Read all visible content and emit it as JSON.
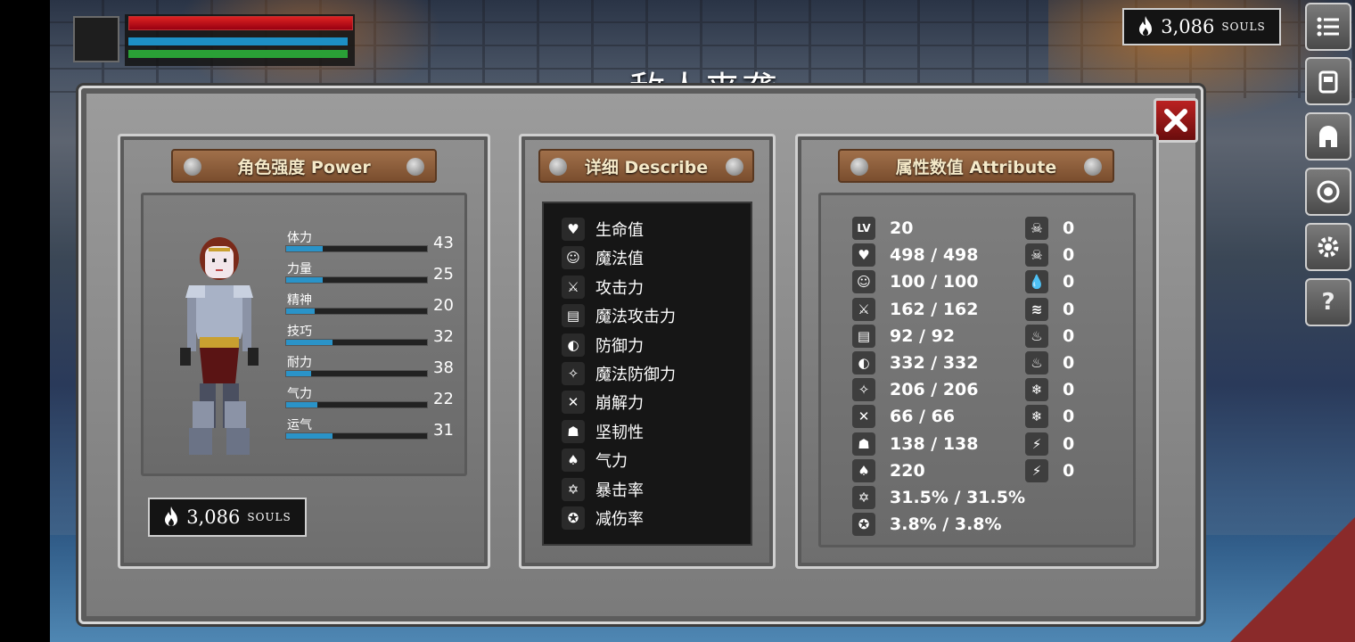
{
  "souls": {
    "value": "3,086",
    "unit": "SOULS"
  },
  "title": "敌人来袭",
  "panels": {
    "power_title": "角色强度 Power",
    "describe_title": "详细 Describe",
    "attribute_title": "属性数值 Attribute"
  },
  "power_stats": [
    {
      "label": "体力",
      "value": "43",
      "fill": 0.26
    },
    {
      "label": "力量",
      "value": "25",
      "fill": 0.26
    },
    {
      "label": "精神",
      "value": "20",
      "fill": 0.2
    },
    {
      "label": "技巧",
      "value": "32",
      "fill": 0.33
    },
    {
      "label": "耐力",
      "value": "38",
      "fill": 0.18
    },
    {
      "label": "气力",
      "value": "22",
      "fill": 0.22
    },
    {
      "label": "运气",
      "value": "31",
      "fill": 0.33
    }
  ],
  "describe": [
    {
      "label": "生命值",
      "icon": "heart-icon"
    },
    {
      "label": "魔法值",
      "icon": "head-icon"
    },
    {
      "label": "攻击力",
      "icon": "sword-icon"
    },
    {
      "label": "魔法攻击力",
      "icon": "spellbook-icon"
    },
    {
      "label": "防御力",
      "icon": "shield-icon"
    },
    {
      "label": "魔法防御力",
      "icon": "magic-shield-icon"
    },
    {
      "label": "崩解力",
      "icon": "break-icon"
    },
    {
      "label": "坚韧性",
      "icon": "helmet-icon"
    },
    {
      "label": "气力",
      "icon": "lungs-icon"
    },
    {
      "label": "暴击率",
      "icon": "crit-star-icon"
    },
    {
      "label": "减伤率",
      "icon": "reduction-badge-icon"
    }
  ],
  "attributes_left": [
    {
      "icon": "level-icon",
      "icon_text": "LV",
      "value": "20"
    },
    {
      "icon": "heart-icon",
      "icon_text": "♥",
      "value": "498 / 498"
    },
    {
      "icon": "head-icon",
      "icon_text": "☺",
      "value": "100 / 100"
    },
    {
      "icon": "sword-icon",
      "icon_text": "⚔",
      "value": "162 / 162"
    },
    {
      "icon": "spellbook-icon",
      "icon_text": "▤",
      "value": "92 / 92"
    },
    {
      "icon": "shield-icon",
      "icon_text": "◐",
      "value": "332 / 332"
    },
    {
      "icon": "magic-shield-icon",
      "icon_text": "✧",
      "value": "206 / 206"
    },
    {
      "icon": "break-icon",
      "icon_text": "✕",
      "value": "66 / 66"
    },
    {
      "icon": "helmet-icon",
      "icon_text": "☗",
      "value": "138 / 138"
    },
    {
      "icon": "lungs-icon",
      "icon_text": "♠",
      "value": "220"
    },
    {
      "icon": "crit-star-icon",
      "icon_text": "✡",
      "value": "31.5% / 31.5%"
    },
    {
      "icon": "reduction-badge-icon",
      "icon_text": "✪",
      "value": "3.8% / 3.8%"
    }
  ],
  "attributes_right": [
    {
      "icon": "poison-skull-icon",
      "icon_text": "☠",
      "value": "0"
    },
    {
      "icon": "bleed-skull-icon",
      "icon_text": "☠",
      "value": "0"
    },
    {
      "icon": "water-drop-icon",
      "icon_text": "💧",
      "value": "0"
    },
    {
      "icon": "claw-icon",
      "icon_text": "≋",
      "value": "0"
    },
    {
      "icon": "fire-icon",
      "icon_text": "♨",
      "value": "0"
    },
    {
      "icon": "burn-icon",
      "icon_text": "♨",
      "value": "0"
    },
    {
      "icon": "frost-icon",
      "icon_text": "❄",
      "value": "0"
    },
    {
      "icon": "frost-break-icon",
      "icon_text": "❄",
      "value": "0"
    },
    {
      "icon": "lightning-icon",
      "icon_text": "⚡",
      "value": "0"
    },
    {
      "icon": "lightning-break-icon",
      "icon_text": "⚡",
      "value": "0"
    }
  ],
  "hud": {
    "hp_fill": 1.0,
    "mp_fill": 1.0,
    "stamina_fill": 1.0
  },
  "side_menu": [
    "menu-icon",
    "inventory-icon",
    "helmet-icon",
    "skill-icon",
    "settings-icon",
    "help-icon"
  ],
  "colors": {
    "hp": "#d22222",
    "mp": "#1d8fc4",
    "stamina": "#2aa036",
    "stat_bar": "#2a93c8",
    "close": "#b22222"
  }
}
